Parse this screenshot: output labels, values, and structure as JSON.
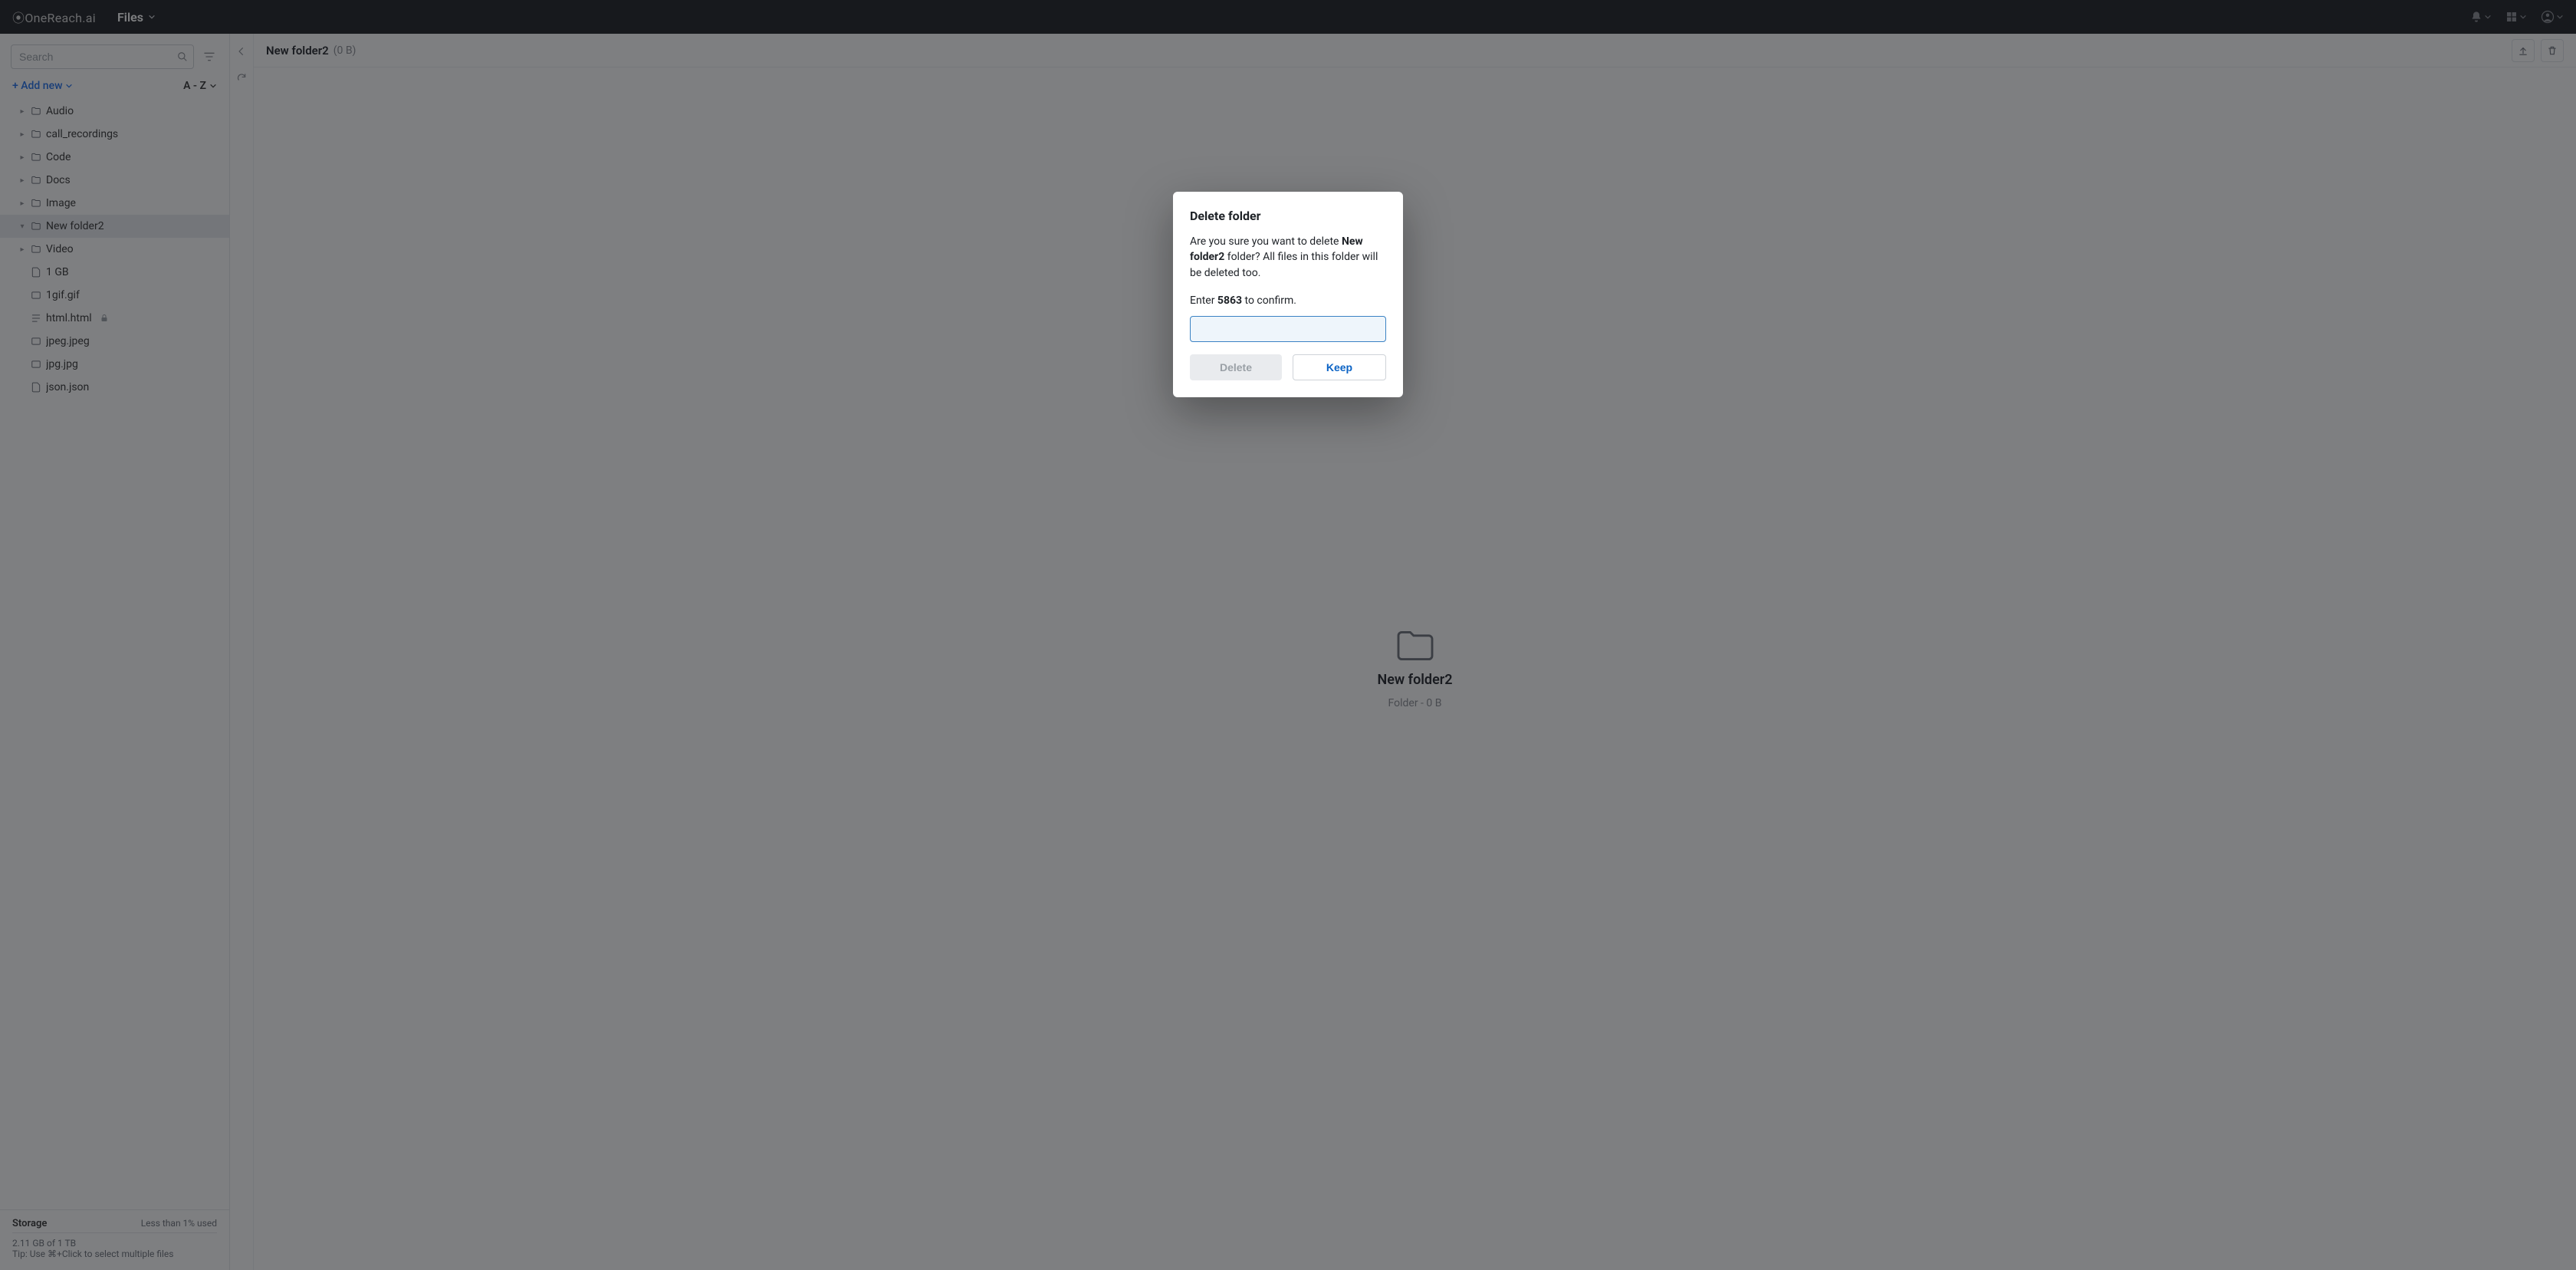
{
  "topbar": {
    "brand": "OneReach.ai",
    "section": "Files"
  },
  "sidebar": {
    "search_placeholder": "Search",
    "add_new_label": "+ Add new",
    "sort_label": "A - Z",
    "folders": [
      {
        "label": "Audio",
        "selected": false
      },
      {
        "label": "call_recordings",
        "selected": false
      },
      {
        "label": "Code",
        "selected": false
      },
      {
        "label": "Docs",
        "selected": false
      },
      {
        "label": "Image",
        "selected": false
      },
      {
        "label": "New folder2",
        "selected": true
      },
      {
        "label": "Video",
        "selected": false
      }
    ],
    "files": [
      {
        "label": "1 GB",
        "icon": "file",
        "locked": false
      },
      {
        "label": "1gif.gif",
        "icon": "gif",
        "locked": false
      },
      {
        "label": "html.html",
        "icon": "html",
        "locked": true
      },
      {
        "label": "jpeg.jpeg",
        "icon": "image",
        "locked": false
      },
      {
        "label": "jpg.jpg",
        "icon": "image",
        "locked": false
      },
      {
        "label": "json.json",
        "icon": "file",
        "locked": false
      }
    ],
    "storage": {
      "title": "Storage",
      "usage_pct": "Less than 1% used",
      "detail": "2.11 GB of 1 TB",
      "tip": "Tip: Use ⌘+Click to select multiple files"
    }
  },
  "content": {
    "breadcrumb_title": "New folder2",
    "breadcrumb_size": "(0 B)",
    "folder_card": {
      "name": "New folder2",
      "meta": "Folder - 0 B"
    }
  },
  "modal": {
    "title": "Delete folder",
    "line1": "Are you sure you want to delete",
    "target_name": "New folder2",
    "line1_tail": " folder? All files in this folder will be deleted too.",
    "confirm_prefix": "Enter ",
    "confirm_code": "5863",
    "confirm_suffix": " to confirm.",
    "delete_label": "Delete",
    "keep_label": "Keep"
  }
}
